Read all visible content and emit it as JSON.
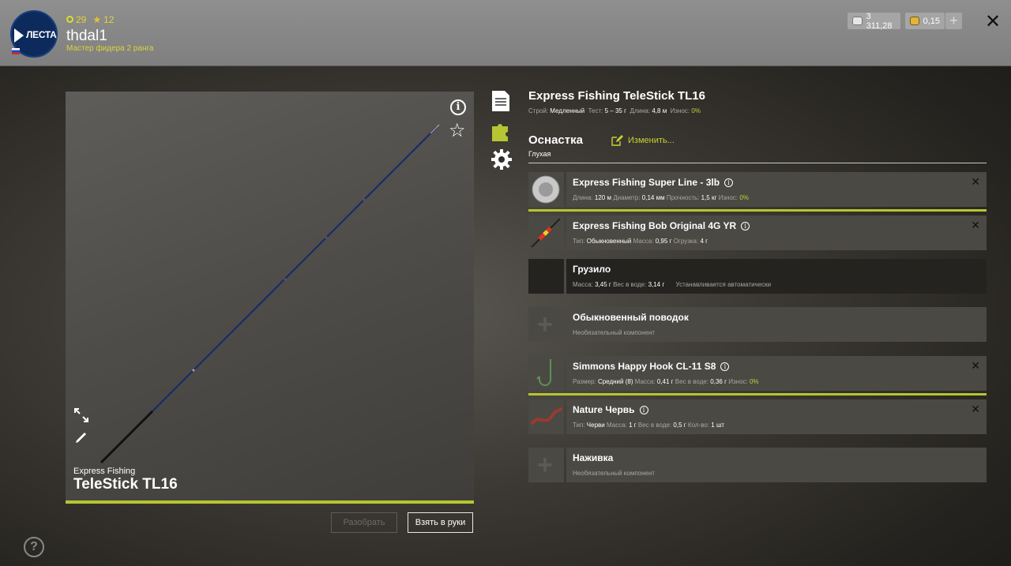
{
  "header": {
    "logo_text": "ЛЕСТА",
    "stats": {
      "level_a": "29",
      "level_b": "12"
    },
    "username": "thdal1",
    "rank": "Мастер фидера 2 ранга",
    "silver": "3 311,28",
    "gold": "0,15",
    "add_label": "+",
    "close_label": "✕"
  },
  "preview": {
    "brand": "Express Fishing",
    "model": "TeleStick TL16",
    "btn_disassemble": "Разобрать",
    "btn_take": "Взять в руки"
  },
  "rod": {
    "title": "Express Fishing TeleStick TL16",
    "specs": [
      {
        "label": "Строй:",
        "value": "Медленный"
      },
      {
        "label": "Тест:",
        "value": "5 – 35 г"
      },
      {
        "label": "Длина:",
        "value": "4,8 м"
      },
      {
        "label": "Износ:",
        "value": "0%"
      }
    ]
  },
  "rig": {
    "title": "Оснастка",
    "edit_label": "Изменить...",
    "type": "Глухая",
    "items": [
      {
        "name": "Express Fishing Super Line - 3lb",
        "meta": [
          {
            "label": "Длина:",
            "value": "120 м"
          },
          {
            "label": "Диаметр:",
            "value": "0,14 мм"
          },
          {
            "label": "Прочность:",
            "value": "1,5 кг"
          },
          {
            "label": "Износ:",
            "value": "0%"
          }
        ]
      },
      {
        "name": "Express Fishing Bob Original 4G YR",
        "meta": [
          {
            "label": "Тип:",
            "value": "Обыкновенный"
          },
          {
            "label": "Масса:",
            "value": "0,95 г"
          },
          {
            "label": "Огрузка:",
            "value": "4 г"
          }
        ]
      },
      {
        "name": "Грузило",
        "meta": [
          {
            "label": "Масса:",
            "value": "3,45 г"
          },
          {
            "label": "Вес в воде:",
            "value": "3,14 г"
          }
        ],
        "note": "Устанавливается автоматически"
      },
      {
        "name": "Обыкновенный поводок",
        "note": "Необязательный компонент"
      },
      {
        "name": "Simmons Happy Hook CL-11 S8",
        "meta": [
          {
            "label": "Размер:",
            "value": "Средний (8)"
          },
          {
            "label": "Масса:",
            "value": "0,41 г"
          },
          {
            "label": "Вес в воде:",
            "value": "0,36 г"
          },
          {
            "label": "Износ:",
            "value": "0%"
          }
        ]
      },
      {
        "name": "Nature Червь",
        "meta": [
          {
            "label": "Тип:",
            "value": "Черви"
          },
          {
            "label": "Масса:",
            "value": "1 г"
          },
          {
            "label": "Вес в воде:",
            "value": "0,5 г"
          },
          {
            "label": "Кол-во:",
            "value": "1 шт"
          }
        ]
      },
      {
        "name": "Наживка",
        "note": "Необязательный компонент"
      }
    ]
  },
  "colors": {
    "accent": "#b6c531",
    "link": "#c5d332"
  }
}
